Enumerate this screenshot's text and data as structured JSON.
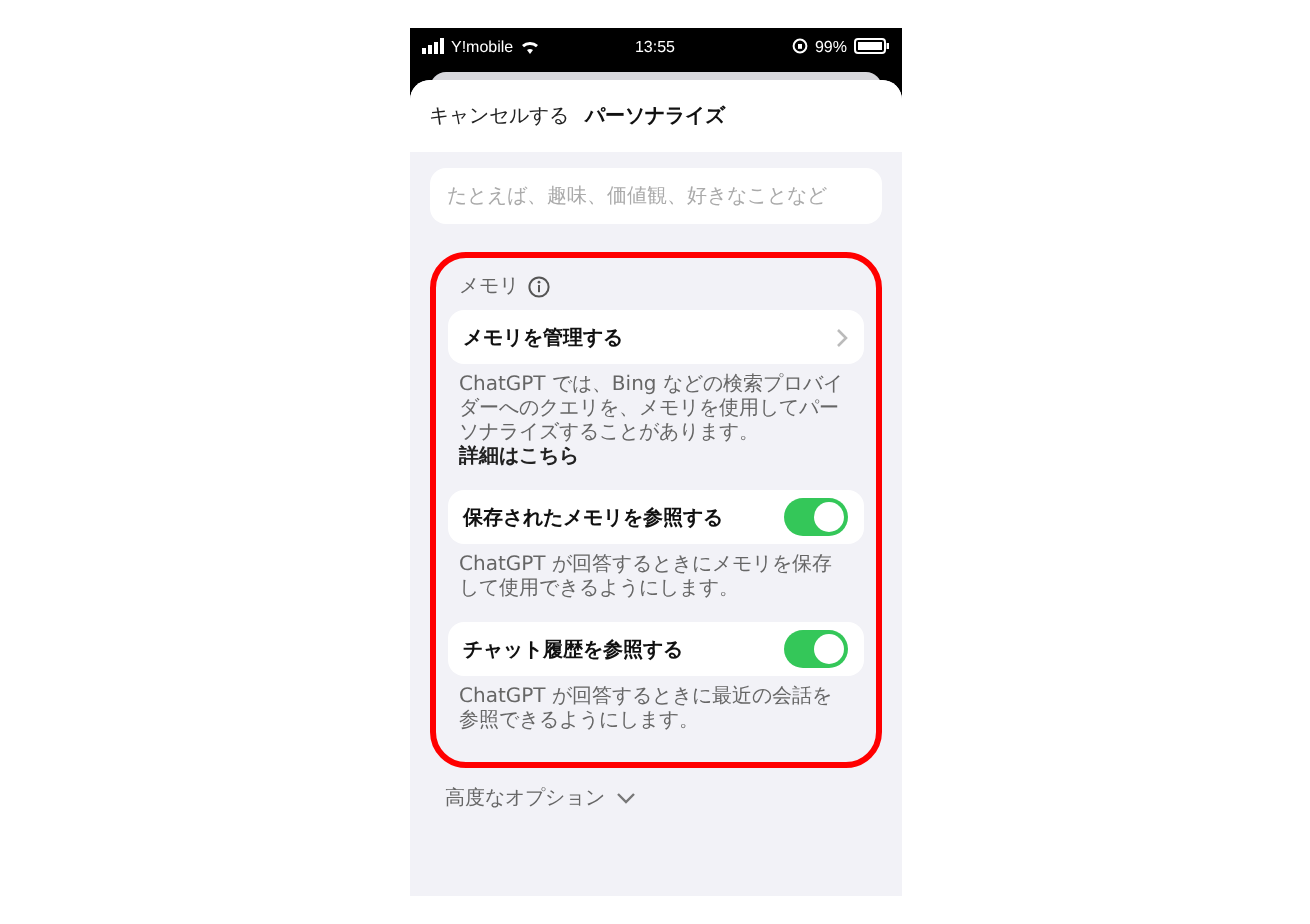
{
  "status_bar": {
    "carrier": "Y!mobile",
    "time": "13:55",
    "battery": "99%"
  },
  "header": {
    "cancel": "キャンセルする",
    "title": "パーソナライズ"
  },
  "input": {
    "placeholder": "たとえば、趣味、価値観、好きなことなど"
  },
  "memory": {
    "heading": "メモリ",
    "items": [
      {
        "kind": "link",
        "label": "メモリを管理する",
        "note": "ChatGPT では、Bing などの検索プロバイダーへのクエリを、メモリを使用してパーソナライズすることがあります。",
        "link": "詳細はこちら"
      },
      {
        "kind": "toggle",
        "label": "保存されたメモリを参照する",
        "on": true,
        "note": "ChatGPT が回答するときにメモリを保存して使用できるようにします。"
      },
      {
        "kind": "toggle",
        "label": "チャット履歴を参照する",
        "on": true,
        "note": "ChatGPT が回答するときに最近の会話を参照できるようにします。"
      }
    ]
  },
  "advanced": {
    "label": "高度なオプション",
    "expanded": false
  }
}
